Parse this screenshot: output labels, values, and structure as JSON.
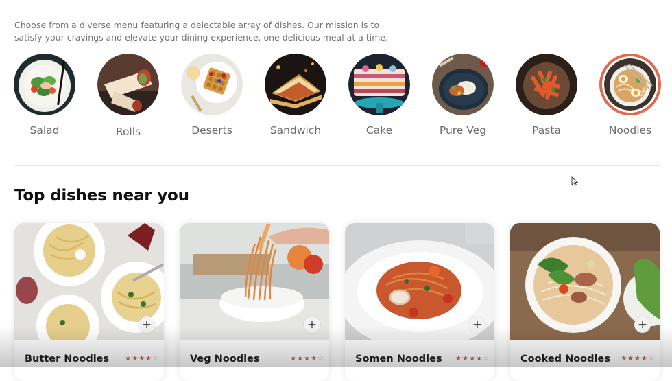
{
  "intro": {
    "text": "Choose from a diverse menu featuring a delectable array of dishes. Our mission is to satisfy your cravings and elevate your dining experience, one delicious meal at a time."
  },
  "menu": {
    "items": [
      {
        "label": "Salad",
        "icon": "salad-image",
        "active": false
      },
      {
        "label": "Rolls",
        "icon": "rolls-image",
        "active": false
      },
      {
        "label": "Deserts",
        "icon": "deserts-image",
        "active": false
      },
      {
        "label": "Sandwich",
        "icon": "sandwich-image",
        "active": false
      },
      {
        "label": "Cake",
        "icon": "cake-image",
        "active": false
      },
      {
        "label": "Pure Veg",
        "icon": "pure-veg-image",
        "active": false
      },
      {
        "label": "Pasta",
        "icon": "pasta-image",
        "active": false
      },
      {
        "label": "Noodles",
        "icon": "noodles-image",
        "active": true
      }
    ]
  },
  "section": {
    "title": "Top dishes near you"
  },
  "dishes": [
    {
      "name": "Butter Noodles",
      "rating": 4,
      "max_rating": 5,
      "add_label": "+"
    },
    {
      "name": "Veg Noodles",
      "rating": 4,
      "max_rating": 5,
      "add_label": "+"
    },
    {
      "name": "Somen Noodles",
      "rating": 4,
      "max_rating": 5,
      "add_label": "+"
    },
    {
      "name": "Cooked Noodles",
      "rating": 4,
      "max_rating": 5,
      "add_label": "+"
    }
  ],
  "colors": {
    "accent": "#e06a4a",
    "star": "#d05b36",
    "muted_text": "#747474"
  }
}
